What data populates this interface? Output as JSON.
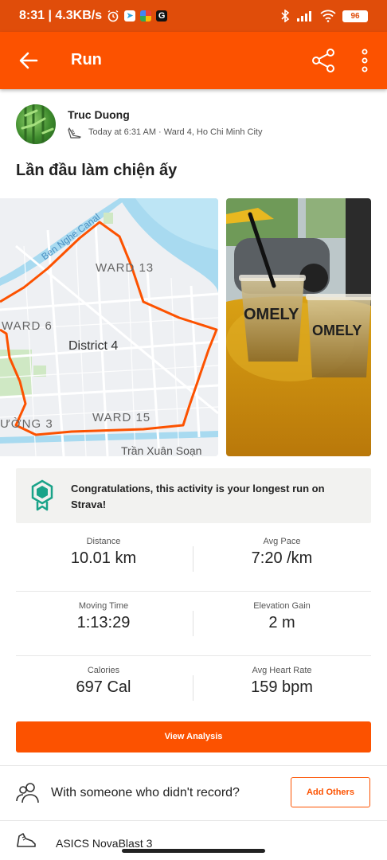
{
  "status_bar": {
    "time_speed": "8:31 | 4.3KB/s",
    "battery": "96",
    "app_g": "G"
  },
  "app_bar": {
    "title": "Run",
    "icons": [
      "back-arrow-icon",
      "share-icon",
      "more-vert-icon"
    ]
  },
  "athlete": {
    "name": "Truc Duong",
    "meta": "Today at 6:31 AM · Ward 4, Ho Chi Minh City",
    "activity_type_icon": "shoe-icon"
  },
  "activity": {
    "title": "Lần đầu làm chiện ấy"
  },
  "map": {
    "labels": {
      "canal": "Ben Nghe Canal",
      "ward13": "WARD 13",
      "ward6": "WARD 6",
      "district4": "District 4",
      "ward15": "WARD 15",
      "ward3": "ƯỜNG 3",
      "street": "Trần Xuân Soạn"
    },
    "route_color": "#fc5200"
  },
  "photo": {
    "cup_text_left": "OMELY",
    "cup_text_right": "OMELY"
  },
  "achievement": {
    "text": "Congratulations, this activity is your longest run on Strava!",
    "icon": "medal-badge-icon"
  },
  "stats": [
    {
      "left": {
        "label": "Distance",
        "value": "10.01 km"
      },
      "right": {
        "label": "Avg Pace",
        "value": "7:20 /km"
      }
    },
    {
      "left": {
        "label": "Moving Time",
        "value": "1:13:29"
      },
      "right": {
        "label": "Elevation Gain",
        "value": "2 m"
      }
    },
    {
      "left": {
        "label": "Calories",
        "value": "697 Cal"
      },
      "right": {
        "label": "Avg Heart Rate",
        "value": "159 bpm"
      }
    }
  ],
  "buttons": {
    "view_analysis": "View Analysis",
    "add_others": "Add Others"
  },
  "with_row": {
    "text": "With someone who didn't record?"
  },
  "gear_row": {
    "text": "ASICS NovaBlast 3"
  },
  "colors": {
    "brand": "#fc5200",
    "status_bar": "#e04d0a"
  }
}
